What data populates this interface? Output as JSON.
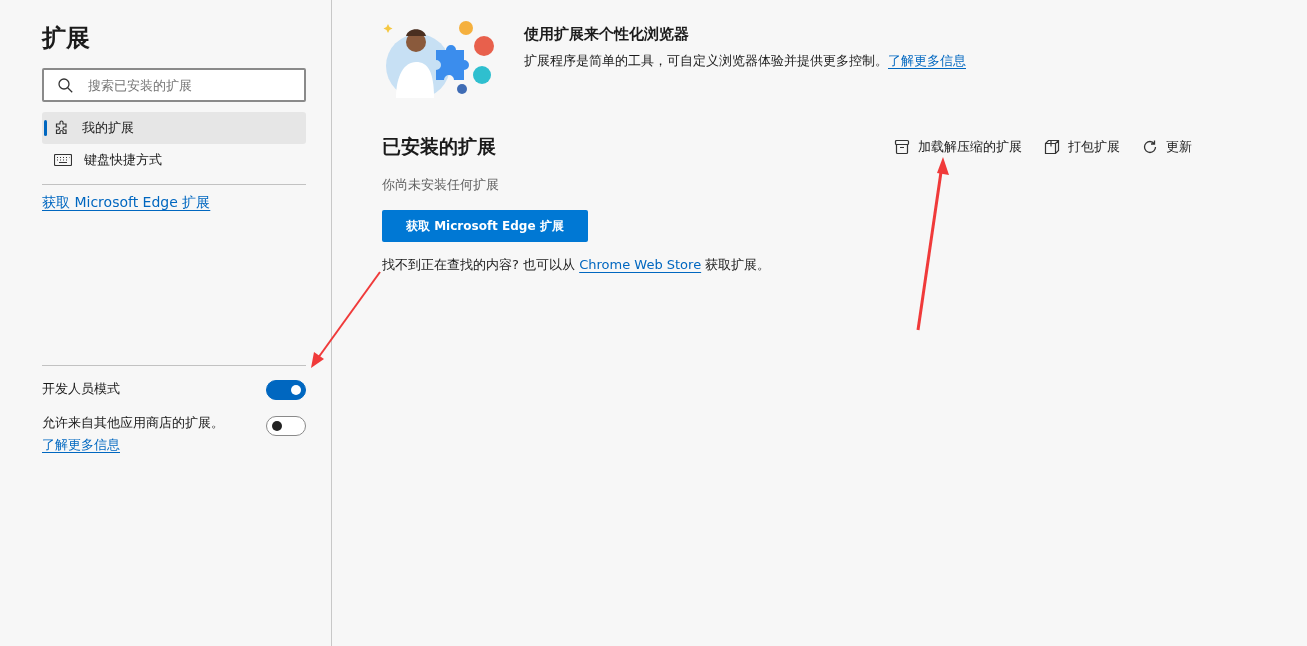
{
  "sidebar": {
    "title": "扩展",
    "search": {
      "placeholder": "搜索已安装的扩展"
    },
    "items": [
      {
        "label": "我的扩展",
        "kind": "puzzle",
        "selected": true
      },
      {
        "label": "键盘快捷方式",
        "kind": "keyboard",
        "selected": false
      }
    ],
    "get_link": "获取 Microsoft Edge 扩展",
    "toggles": [
      {
        "label": "开发人员模式",
        "on": true
      },
      {
        "label": "允许来自其他应用商店的扩展。",
        "link": "了解更多信息",
        "on": false
      }
    ]
  },
  "banner": {
    "title": "使用扩展来个性化浏览器",
    "text": "扩展程序是简单的工具，可自定义浏览器体验并提供更多控制。",
    "link": "了解更多信息"
  },
  "installed": {
    "title": "已安装的扩展",
    "actions": [
      {
        "label": "加载解压缩的扩展",
        "kind": "load"
      },
      {
        "label": "打包扩展",
        "kind": "pack"
      },
      {
        "label": "更新",
        "kind": "update"
      }
    ],
    "empty_text": "你尚未安装任何扩展",
    "button": "获取 Microsoft Edge 扩展",
    "hint": "找不到正在查找的内容? 也可以从 ",
    "hint_link": "Chrome Web Store",
    "hint_end": " 获取扩展。"
  }
}
